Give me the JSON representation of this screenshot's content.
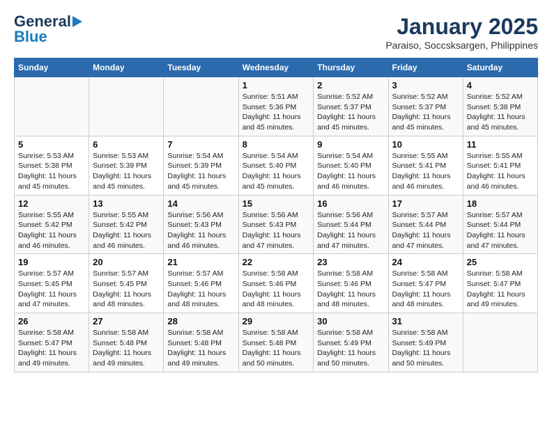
{
  "logo": {
    "general": "General",
    "blue": "Blue"
  },
  "header": {
    "month": "January 2025",
    "location": "Paraiso, Soccsksargen, Philippines"
  },
  "days_of_week": [
    "Sunday",
    "Monday",
    "Tuesday",
    "Wednesday",
    "Thursday",
    "Friday",
    "Saturday"
  ],
  "weeks": [
    [
      {
        "day": "",
        "info": ""
      },
      {
        "day": "",
        "info": ""
      },
      {
        "day": "",
        "info": ""
      },
      {
        "day": "1",
        "sunrise": "5:51 AM",
        "sunset": "5:36 PM",
        "daylight": "11 hours and 45 minutes."
      },
      {
        "day": "2",
        "sunrise": "5:52 AM",
        "sunset": "5:37 PM",
        "daylight": "11 hours and 45 minutes."
      },
      {
        "day": "3",
        "sunrise": "5:52 AM",
        "sunset": "5:37 PM",
        "daylight": "11 hours and 45 minutes."
      },
      {
        "day": "4",
        "sunrise": "5:52 AM",
        "sunset": "5:38 PM",
        "daylight": "11 hours and 45 minutes."
      }
    ],
    [
      {
        "day": "5",
        "sunrise": "5:53 AM",
        "sunset": "5:38 PM",
        "daylight": "11 hours and 45 minutes."
      },
      {
        "day": "6",
        "sunrise": "5:53 AM",
        "sunset": "5:39 PM",
        "daylight": "11 hours and 45 minutes."
      },
      {
        "day": "7",
        "sunrise": "5:54 AM",
        "sunset": "5:39 PM",
        "daylight": "11 hours and 45 minutes."
      },
      {
        "day": "8",
        "sunrise": "5:54 AM",
        "sunset": "5:40 PM",
        "daylight": "11 hours and 45 minutes."
      },
      {
        "day": "9",
        "sunrise": "5:54 AM",
        "sunset": "5:40 PM",
        "daylight": "11 hours and 46 minutes."
      },
      {
        "day": "10",
        "sunrise": "5:55 AM",
        "sunset": "5:41 PM",
        "daylight": "11 hours and 46 minutes."
      },
      {
        "day": "11",
        "sunrise": "5:55 AM",
        "sunset": "5:41 PM",
        "daylight": "11 hours and 46 minutes."
      }
    ],
    [
      {
        "day": "12",
        "sunrise": "5:55 AM",
        "sunset": "5:42 PM",
        "daylight": "11 hours and 46 minutes."
      },
      {
        "day": "13",
        "sunrise": "5:55 AM",
        "sunset": "5:42 PM",
        "daylight": "11 hours and 46 minutes."
      },
      {
        "day": "14",
        "sunrise": "5:56 AM",
        "sunset": "5:43 PM",
        "daylight": "11 hours and 46 minutes."
      },
      {
        "day": "15",
        "sunrise": "5:56 AM",
        "sunset": "5:43 PM",
        "daylight": "11 hours and 47 minutes."
      },
      {
        "day": "16",
        "sunrise": "5:56 AM",
        "sunset": "5:44 PM",
        "daylight": "11 hours and 47 minutes."
      },
      {
        "day": "17",
        "sunrise": "5:57 AM",
        "sunset": "5:44 PM",
        "daylight": "11 hours and 47 minutes."
      },
      {
        "day": "18",
        "sunrise": "5:57 AM",
        "sunset": "5:44 PM",
        "daylight": "11 hours and 47 minutes."
      }
    ],
    [
      {
        "day": "19",
        "sunrise": "5:57 AM",
        "sunset": "5:45 PM",
        "daylight": "11 hours and 47 minutes."
      },
      {
        "day": "20",
        "sunrise": "5:57 AM",
        "sunset": "5:45 PM",
        "daylight": "11 hours and 48 minutes."
      },
      {
        "day": "21",
        "sunrise": "5:57 AM",
        "sunset": "5:46 PM",
        "daylight": "11 hours and 48 minutes."
      },
      {
        "day": "22",
        "sunrise": "5:58 AM",
        "sunset": "5:46 PM",
        "daylight": "11 hours and 48 minutes."
      },
      {
        "day": "23",
        "sunrise": "5:58 AM",
        "sunset": "5:46 PM",
        "daylight": "11 hours and 48 minutes."
      },
      {
        "day": "24",
        "sunrise": "5:58 AM",
        "sunset": "5:47 PM",
        "daylight": "11 hours and 48 minutes."
      },
      {
        "day": "25",
        "sunrise": "5:58 AM",
        "sunset": "5:47 PM",
        "daylight": "11 hours and 49 minutes."
      }
    ],
    [
      {
        "day": "26",
        "sunrise": "5:58 AM",
        "sunset": "5:47 PM",
        "daylight": "11 hours and 49 minutes."
      },
      {
        "day": "27",
        "sunrise": "5:58 AM",
        "sunset": "5:48 PM",
        "daylight": "11 hours and 49 minutes."
      },
      {
        "day": "28",
        "sunrise": "5:58 AM",
        "sunset": "5:48 PM",
        "daylight": "11 hours and 49 minutes."
      },
      {
        "day": "29",
        "sunrise": "5:58 AM",
        "sunset": "5:48 PM",
        "daylight": "11 hours and 50 minutes."
      },
      {
        "day": "30",
        "sunrise": "5:58 AM",
        "sunset": "5:49 PM",
        "daylight": "11 hours and 50 minutes."
      },
      {
        "day": "31",
        "sunrise": "5:58 AM",
        "sunset": "5:49 PM",
        "daylight": "11 hours and 50 minutes."
      },
      {
        "day": "",
        "info": ""
      }
    ]
  ],
  "labels": {
    "sunrise": "Sunrise:",
    "sunset": "Sunset:",
    "daylight": "Daylight:"
  }
}
